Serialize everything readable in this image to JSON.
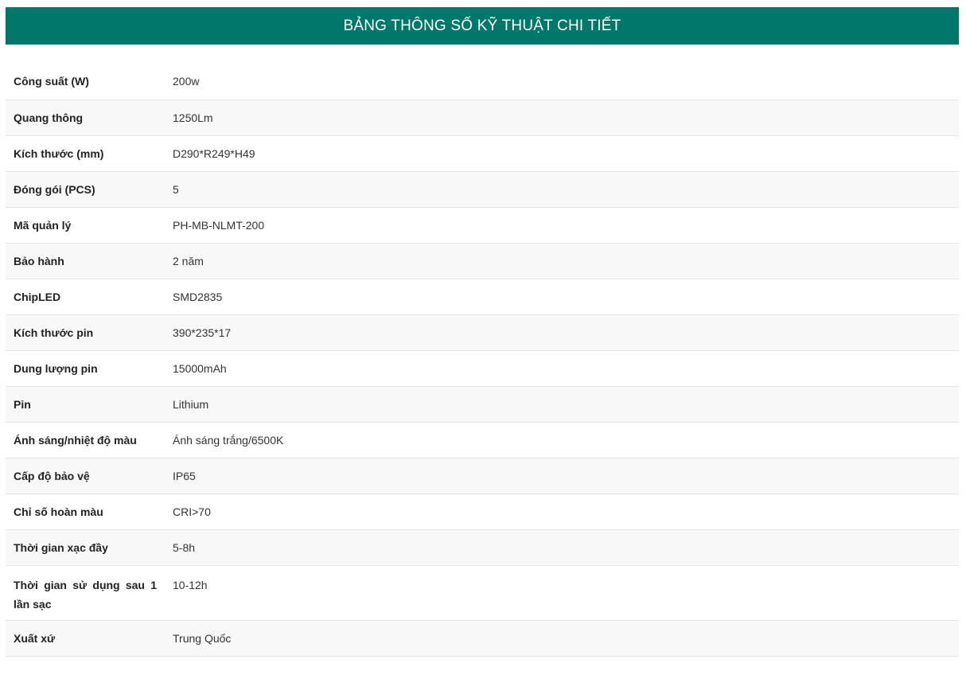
{
  "header": {
    "title": "BẢNG THÔNG SỐ KỸ THUẬT CHI TIẾT"
  },
  "specs": [
    {
      "label": "Công suất (W)",
      "value": "200w"
    },
    {
      "label": "Quang thông",
      "value": "1250Lm"
    },
    {
      "label": "Kích thước (mm)",
      "value": "D290*R249*H49"
    },
    {
      "label": "Đóng gói (PCS)",
      "value": "5"
    },
    {
      "label": "Mã quản lý",
      "value": "PH-MB-NLMT-200"
    },
    {
      "label": "Bảo hành",
      "value": "2 năm"
    },
    {
      "label": "ChipLED",
      "value": "SMD2835"
    },
    {
      "label": "Kích thước pin",
      "value": "390*235*17"
    },
    {
      "label": "Dung lượng pin",
      "value": "15000mAh"
    },
    {
      "label": "Pin",
      "value": "Lithium"
    },
    {
      "label": "Ánh sáng/nhiệt độ màu",
      "value": "Ánh sáng trắng/6500K"
    },
    {
      "label": "Cấp độ bảo vệ",
      "value": "IP65"
    },
    {
      "label": "Chỉ số hoàn màu",
      "value": "CRI>70"
    },
    {
      "label": "Thời gian xạc đầy",
      "value": "5-8h"
    },
    {
      "label": "Thời gian sử dụng sau 1 lần sạc",
      "value": "10-12h"
    },
    {
      "label": "Xuất xứ",
      "value": "Trung Quốc"
    }
  ],
  "colors": {
    "header_bg": "#00776b",
    "header_text": "#ffffff",
    "row_alt_bg": "#f8f8f8",
    "border": "#e4e4e4"
  }
}
